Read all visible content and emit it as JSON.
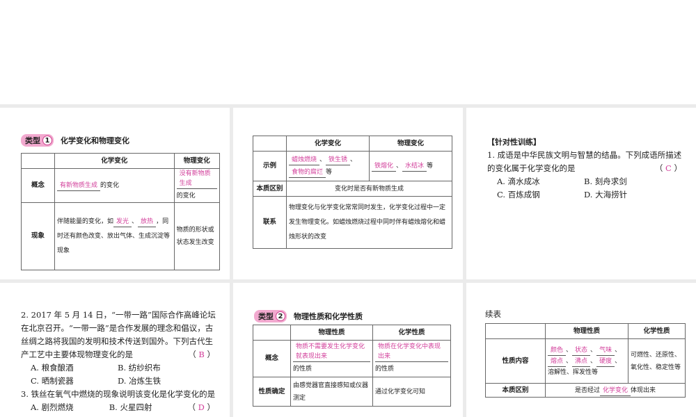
{
  "type1": {
    "badge": "类型",
    "num": "1",
    "title": "化学变化和物理变化",
    "table1": {
      "headers": [
        "化学变化",
        "物理变化"
      ],
      "row1": {
        "label": "概念",
        "chem_blank": "有新物质生成",
        "chem_suffix": "的变化",
        "phys_blank": "没有新物质生成",
        "phys_suffix": "的变化"
      },
      "row2": {
        "label": "现象",
        "chem_pre": "伴随能量的变化，如",
        "chem_blank1": "发光",
        "chem_sep": "、",
        "chem_blank2": "放热",
        "chem_post": "，同时还有颜色改变、放出气体、生成沉淀等现象",
        "phys": "物质的形状或状态发生改变"
      }
    },
    "table2": {
      "headers": [
        "化学变化",
        "物理变化"
      ],
      "row1": {
        "label": "示例",
        "chem_blanks": [
          "蜡烛燃烧",
          "铁生锈",
          "食物的腐烂"
        ],
        "sep": "、",
        "etc": "等",
        "phys_blanks": [
          "铁熔化",
          "水结冰"
        ]
      },
      "row2": {
        "label": "本质区别",
        "value": "变化时是否有新物质生成"
      },
      "row3": {
        "label": "联系",
        "value": "物理变化与化学变化常常同时发生，化学变化过程中一定发生物理变化。如蜡烛燃烧过程中同时伴有蜡烛熔化和蜡烛形状的改变"
      }
    }
  },
  "training": {
    "heading": "【针对性训练】",
    "q1": {
      "text": "1. 成语是中华民族文明与智慧的结晶。下列成语所描述的变化属于化学变化的是",
      "answer": "C",
      "options": [
        "A. 滴水成冰",
        "B. 刻舟求剑",
        "C. 百炼成钢",
        "D. 大海捞针"
      ]
    },
    "q2": {
      "text": "2. 2017 年 5 月 14 日，“一带一路”国际合作高峰论坛在北京召开。“一带一路”是合作发展的理念和倡议，古丝绸之路将我国的发明和技术传送到国外。下列古代生产工艺中主要体现物理变化的是",
      "answer": "B",
      "options": [
        "A. 粮食酿酒",
        "B. 纺纱织布",
        "C. 晒制瓷器",
        "D. 冶炼生铁"
      ]
    },
    "q3": {
      "text": "3. 铁丝在氧气中燃烧的现象说明该变化是化学变化的是",
      "answer": "D",
      "options": [
        "A. 剧烈燃烧",
        "B. 火星四射"
      ]
    }
  },
  "type2": {
    "badge": "类型",
    "num": "2",
    "title": "物理性质和化学性质",
    "table1": {
      "headers": [
        "物理性质",
        "化学性质"
      ],
      "row1": {
        "label": "概念",
        "phys_blank": "物质不需要发生化学变化就表现出来",
        "phys_suffix": "的性质",
        "chem_blank": "物质在化学变化中表现出来",
        "chem_suffix": "的性质"
      },
      "row2": {
        "label": "性质确定",
        "phys": "由感觉器官直接感知或仪器测定",
        "chem": "通过化学变化可知"
      }
    },
    "continued": "续表",
    "table2": {
      "headers": [
        "物理性质",
        "化学性质"
      ],
      "row1": {
        "label": "性质内容",
        "phys_blanks": [
          "颜色",
          "状态",
          "气味",
          "熔点",
          "沸点",
          "硬度"
        ],
        "sep": "、",
        "phys_suffix": "、溶解性、挥发性等",
        "chem": "可燃性、还原性、氧化性、稳定性等"
      },
      "row2": {
        "label": "本质区别",
        "pre": "是否经过",
        "blank": "化学变化",
        "post": "体现出来"
      }
    }
  },
  "colors": {
    "answer": "#d23e9a",
    "badge": "#f2a9cf",
    "gap": "#ebebeb"
  }
}
